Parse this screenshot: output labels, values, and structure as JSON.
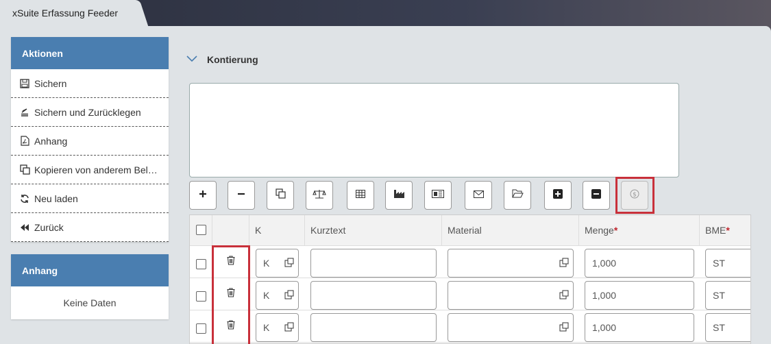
{
  "window": {
    "tab_title": "xSuite Erfassung Feeder"
  },
  "sidebar": {
    "actions": {
      "title": "Aktionen",
      "items": [
        {
          "label": "Sichern",
          "icon": "save-icon"
        },
        {
          "label": "Sichern und Zurücklegen",
          "icon": "stack-save-icon"
        },
        {
          "label": "Anhang",
          "icon": "pdf-file-icon"
        },
        {
          "label": "Kopieren von anderem Bel…",
          "icon": "copy-icon"
        },
        {
          "label": "Neu laden",
          "icon": "refresh-icon"
        },
        {
          "label": "Zurück",
          "icon": "rewind-icon"
        }
      ]
    },
    "attachment": {
      "title": "Anhang",
      "empty_text": "Keine Daten"
    }
  },
  "main": {
    "section_title": "Kontierung",
    "table": {
      "columns": [
        "",
        "",
        "K",
        "Kurztext",
        "Material",
        "Menge",
        "BME"
      ],
      "rows": [
        {
          "k": "K",
          "kurztext": "",
          "material": "",
          "menge": "1,000",
          "bme": "ST"
        },
        {
          "k": "K",
          "kurztext": "",
          "material": "",
          "menge": "1,000",
          "bme": "ST"
        },
        {
          "k": "K",
          "kurztext": "",
          "material": "",
          "menge": "1,000",
          "bme": "ST"
        }
      ]
    }
  },
  "colors": {
    "accent": "#4a7eb0",
    "highlight": "#c8303a",
    "required": "#c0262e"
  }
}
